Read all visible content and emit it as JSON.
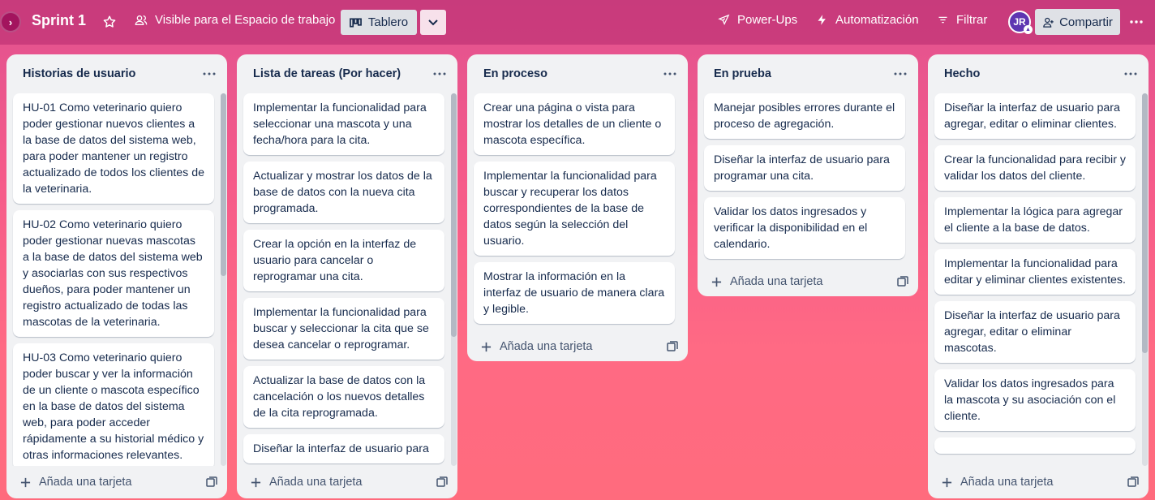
{
  "header": {
    "board_title": "Sprint 1",
    "visibility_label": "Visible para el Espacio de trabajo",
    "view_label": "Tablero",
    "powerups_label": "Power-Ups",
    "automation_label": "Automatización",
    "filter_label": "Filtrar",
    "avatar_initials": "JR",
    "share_label": "Compartir"
  },
  "add_card_label": "Añada una tarjeta",
  "lists": [
    {
      "title": "Historias de usuario",
      "cards": [
        "HU-01 Como veterinario quiero poder gestionar nuevos clientes a la base de datos del sistema web, para poder mantener un registro actualizado de todos los clientes de la veterinaria.",
        "HU-02 Como veterinario quiero poder gestionar nuevas mascotas a la base de datos del sistema web y asociarlas con sus respectivos dueños, para poder mantener un registro actualizado de todas las mascotas de la veterinaria.",
        "HU-03 Como veterinario quiero poder buscar y ver la información de un cliente o mascota específico en la base de datos del sistema web, para poder acceder rápidamente a su historial médico y otras informaciones relevantes."
      ]
    },
    {
      "title": "Lista de tareas (Por hacer)",
      "cards": [
        "Implementar la funcionalidad para seleccionar una mascota y una fecha/hora para la cita.",
        "Actualizar y mostrar los datos de la base de datos con la nueva cita programada.",
        "Crear la opción en la interfaz de usuario para cancelar o reprogramar una cita.",
        "Implementar la funcionalidad para buscar y seleccionar la cita que se desea cancelar o reprogramar.",
        "Actualizar la base de datos con la cancelación o los nuevos detalles de la cita reprogramada.",
        "Diseñar la interfaz de usuario para"
      ]
    },
    {
      "title": "En proceso",
      "cards": [
        "Crear una página o vista para mostrar los detalles de un cliente o mascota específica.",
        "Implementar la funcionalidad para buscar y recuperar los datos correspondientes de la base de datos según la selección del usuario.",
        "Mostrar la información en la interfaz de usuario de manera clara y legible."
      ]
    },
    {
      "title": "En prueba",
      "cards": [
        "Manejar posibles errores durante el proceso de agregación.",
        "Diseñar la interfaz de usuario para programar una cita.",
        "Validar los datos ingresados y verificar la disponibilidad en el calendario."
      ]
    },
    {
      "title": "Hecho",
      "cards": [
        "Diseñar la interfaz de usuario para agregar, editar o eliminar clientes.",
        "Crear la funcionalidad para recibir y validar los datos del cliente.",
        "Implementar la lógica para agregar el cliente a la base de datos.",
        "Implementar la funcionalidad para editar y eliminar clientes existentes.",
        "Diseñar la interfaz de usuario para agregar, editar o eliminar mascotas.",
        "Validar los datos ingresados para la mascota y su asociación con el cliente."
      ]
    }
  ]
}
